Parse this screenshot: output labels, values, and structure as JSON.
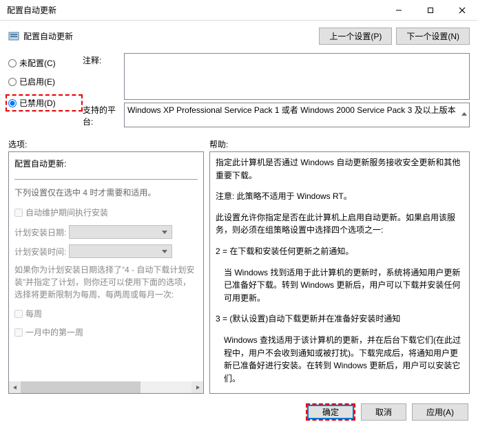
{
  "window": {
    "title": "配置自动更新"
  },
  "header": {
    "title": "配置自动更新",
    "prev_btn": "上一个设置(P)",
    "next_btn": "下一个设置(N)"
  },
  "radios": {
    "not_configured": "未配置(C)",
    "enabled": "已启用(E)",
    "disabled": "已禁用(D)"
  },
  "meta": {
    "comment_label": "注释:",
    "platform_label": "支持的平台:",
    "platform_text": "Windows XP Professional Service Pack 1 或者 Windows 2000 Service Pack 3 及以上版本"
  },
  "section": {
    "options_label": "选项:",
    "help_label": "帮助:"
  },
  "options": {
    "title": "配置自动更新:",
    "note": "下列设置仅在选中 4 时才需要和适用。",
    "chk_auto_maint": "自动维护期间执行安装",
    "sched_day_label": "计划安装日期:",
    "sched_time_label": "计划安装时间:",
    "desc": "如果你为计划安装日期选择了“4 - 自动下载计划安装”并指定了计划，则你还可以使用下面的选项，选择将更新限制为每周、每两周或每月一次:",
    "chk_weekly": "每周",
    "chk_first_week": "一月中的第一周"
  },
  "help": {
    "p1": "指定此计算机是否通过 Windows 自动更新服务接收安全更新和其他重要下载。",
    "p2": "注意: 此策略不适用于 Windows RT。",
    "p3": "此设置允许你指定是否在此计算机上启用自动更新。如果启用该服务，则必须在组策略设置中选择四个选项之一:",
    "p4": "2 = 在下载和安装任何更新之前通知。",
    "p5": "当 Windows 找到适用于此计算机的更新时，系统将通知用户更新已准备好下载。转到 Windows 更新后，用户可以下载并安装任何可用更新。",
    "p6": "3 = (默认设置)自动下载更新并在准备好安装时通知",
    "p7": "Windows 查找适用于该计算机的更新，并在后台下载它们(在此过程中，用户不会收到通知或被打扰)。下载完成后，将通知用户更新已准备好进行安装。在转到 Windows 更新后，用户可以安装它们。"
  },
  "footer": {
    "ok": "确定",
    "cancel": "取消",
    "apply": "应用(A)"
  }
}
